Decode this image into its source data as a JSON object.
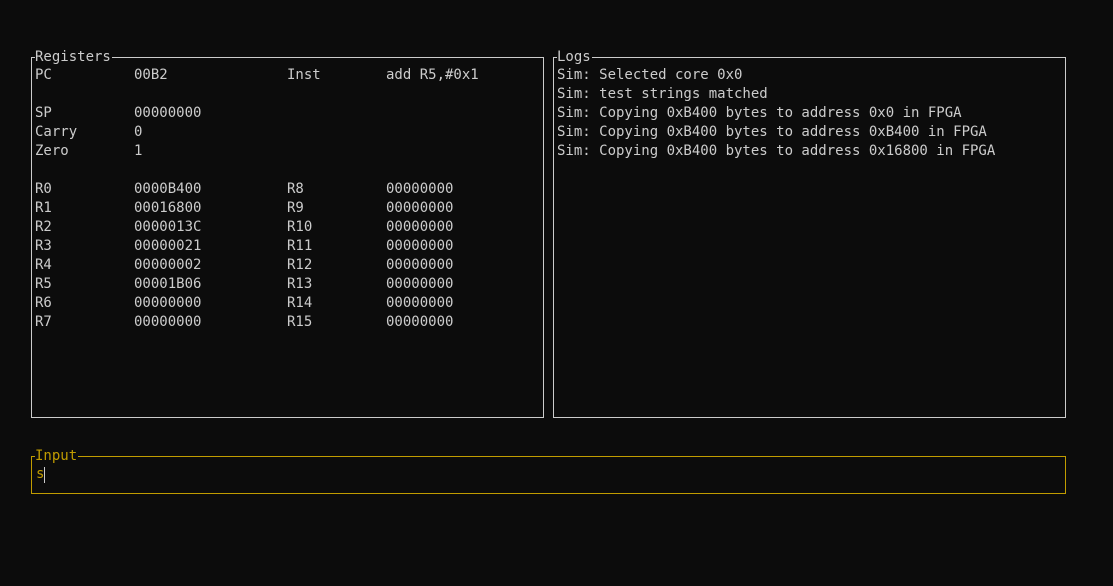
{
  "registers": {
    "title": "Registers",
    "pc_label": "PC",
    "pc_value": "00B2",
    "inst_label": "Inst",
    "inst_value": "add R5,#0x1",
    "sp_label": "SP",
    "sp_value": "00000000",
    "carry_label": "Carry",
    "carry_value": "0",
    "zero_label": "Zero",
    "zero_value": "1",
    "rows": [
      {
        "l1": "R0",
        "v1": "0000B400",
        "l2": "R8",
        "v2": "00000000"
      },
      {
        "l1": "R1",
        "v1": "00016800",
        "l2": "R9",
        "v2": "00000000"
      },
      {
        "l1": "R2",
        "v1": "0000013C",
        "l2": "R10",
        "v2": "00000000"
      },
      {
        "l1": "R3",
        "v1": "00000021",
        "l2": "R11",
        "v2": "00000000"
      },
      {
        "l1": "R4",
        "v1": "00000002",
        "l2": "R12",
        "v2": "00000000"
      },
      {
        "l1": "R5",
        "v1": "00001B06",
        "l2": "R13",
        "v2": "00000000"
      },
      {
        "l1": "R6",
        "v1": "00000000",
        "l2": "R14",
        "v2": "00000000"
      },
      {
        "l1": "R7",
        "v1": "00000000",
        "l2": "R15",
        "v2": "00000000"
      }
    ]
  },
  "logs": {
    "title": "Logs",
    "lines": [
      "Sim: Selected core 0x0",
      "Sim: test strings matched",
      "Sim: Copying 0xB400 bytes to address 0x0 in FPGA",
      "Sim: Copying 0xB400 bytes to address 0xB400 in FPGA",
      "Sim: Copying 0xB400 bytes to address 0x16800 in FPGA"
    ]
  },
  "input": {
    "title": "Input",
    "value": "s"
  },
  "colors": {
    "background": "#0c0c0c",
    "text": "#cccccc",
    "accent": "#c19c00"
  }
}
